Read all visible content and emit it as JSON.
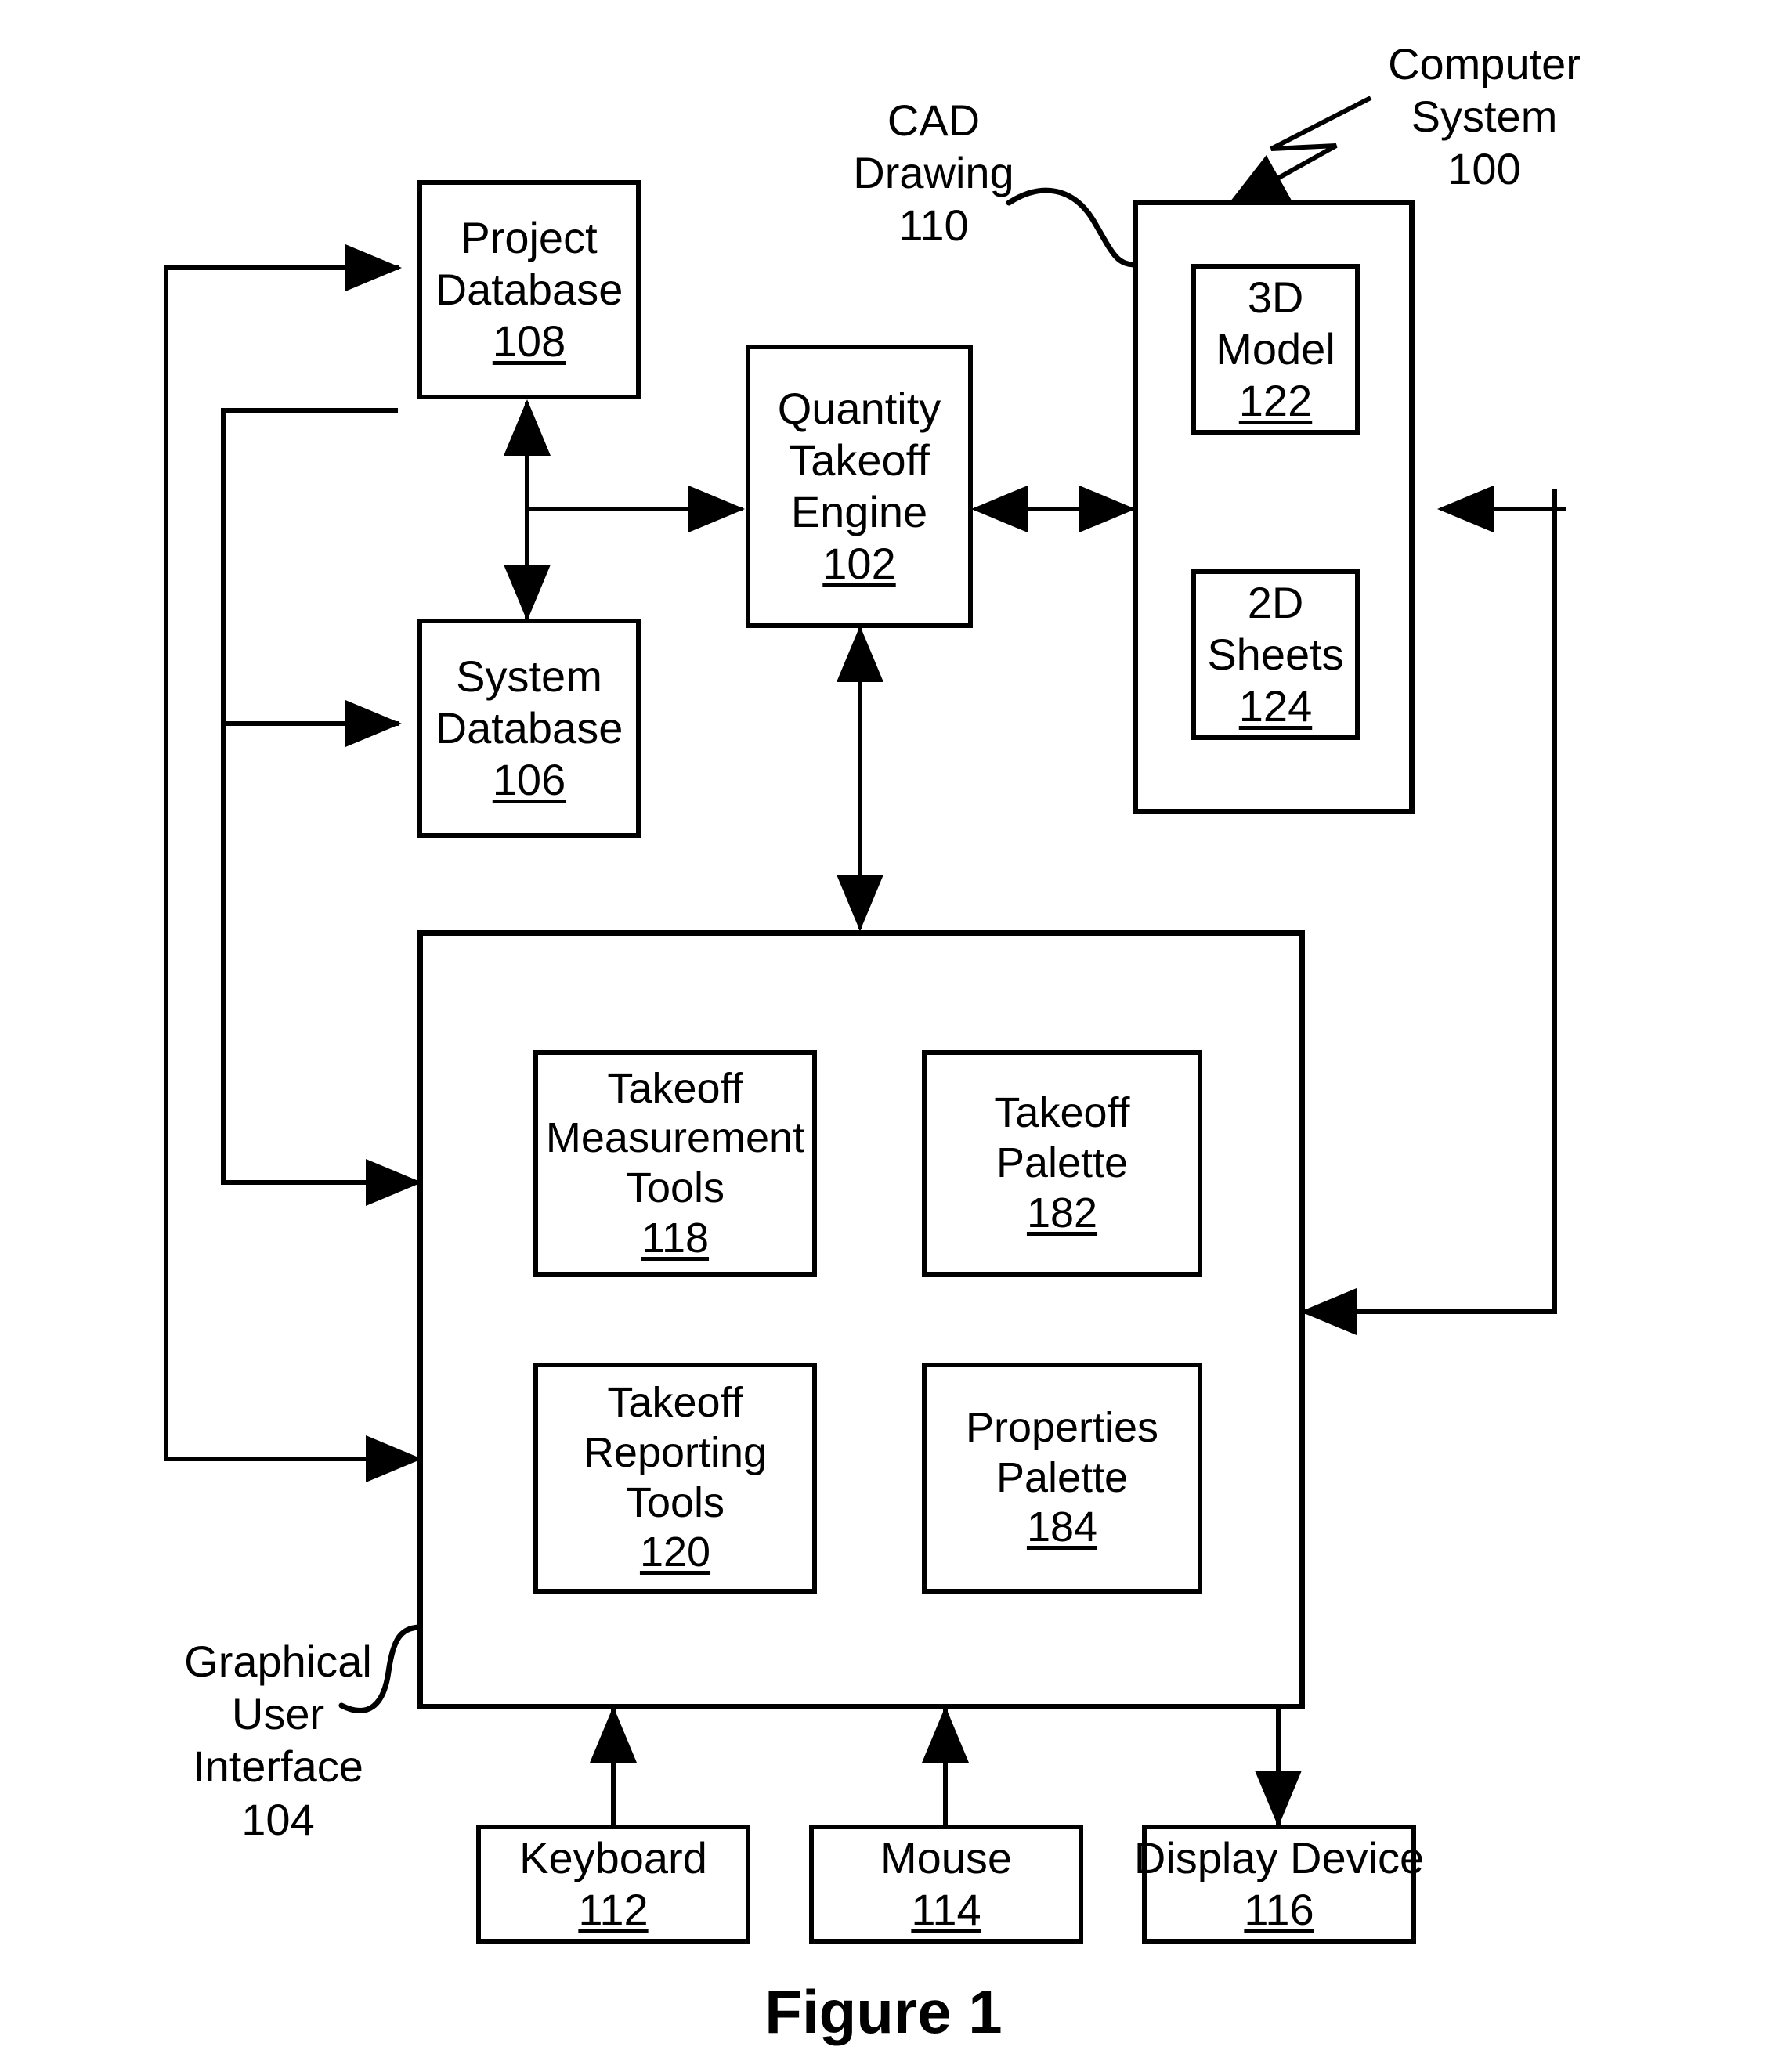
{
  "figure": {
    "caption": "Figure 1"
  },
  "labels": {
    "computer_system": {
      "line1": "Computer",
      "line2": "System",
      "line3": "100"
    },
    "cad_drawing": {
      "line1": "CAD",
      "line2": "Drawing",
      "line3": "110"
    },
    "gui": {
      "line1": "Graphical",
      "line2": "User",
      "line3": "Interface",
      "line4": "104"
    }
  },
  "boxes": {
    "project_database": {
      "line1": "Project",
      "line2": "Database",
      "number": "108"
    },
    "system_database": {
      "line1": "System",
      "line2": "Database",
      "number": "106"
    },
    "quantity_takeoff_engine": {
      "line1": "Quantity",
      "line2": "Takeoff",
      "line3": "Engine",
      "number": "102"
    },
    "model_3d": {
      "line1": "3D",
      "line2": "Model",
      "number": "122"
    },
    "sheets_2d": {
      "line1": "2D",
      "line2": "Sheets",
      "number": "124"
    },
    "takeoff_measurement_tools": {
      "line1": "Takeoff",
      "line2": "Measurement",
      "line3": "Tools",
      "number": "118"
    },
    "takeoff_palette": {
      "line1": "Takeoff",
      "line2": "Palette",
      "number": "182"
    },
    "takeoff_reporting_tools": {
      "line1": "Takeoff",
      "line2": "Reporting",
      "line3": "Tools",
      "number": "120"
    },
    "properties_palette": {
      "line1": "Properties",
      "line2": "Palette",
      "number": "184"
    },
    "keyboard": {
      "line1": "Keyboard",
      "number": "112"
    },
    "mouse": {
      "line1": "Mouse",
      "number": "114"
    },
    "display_device": {
      "line1": "Display Device",
      "number": "116"
    }
  },
  "colors": {
    "stroke": "#000000",
    "background": "#ffffff"
  }
}
